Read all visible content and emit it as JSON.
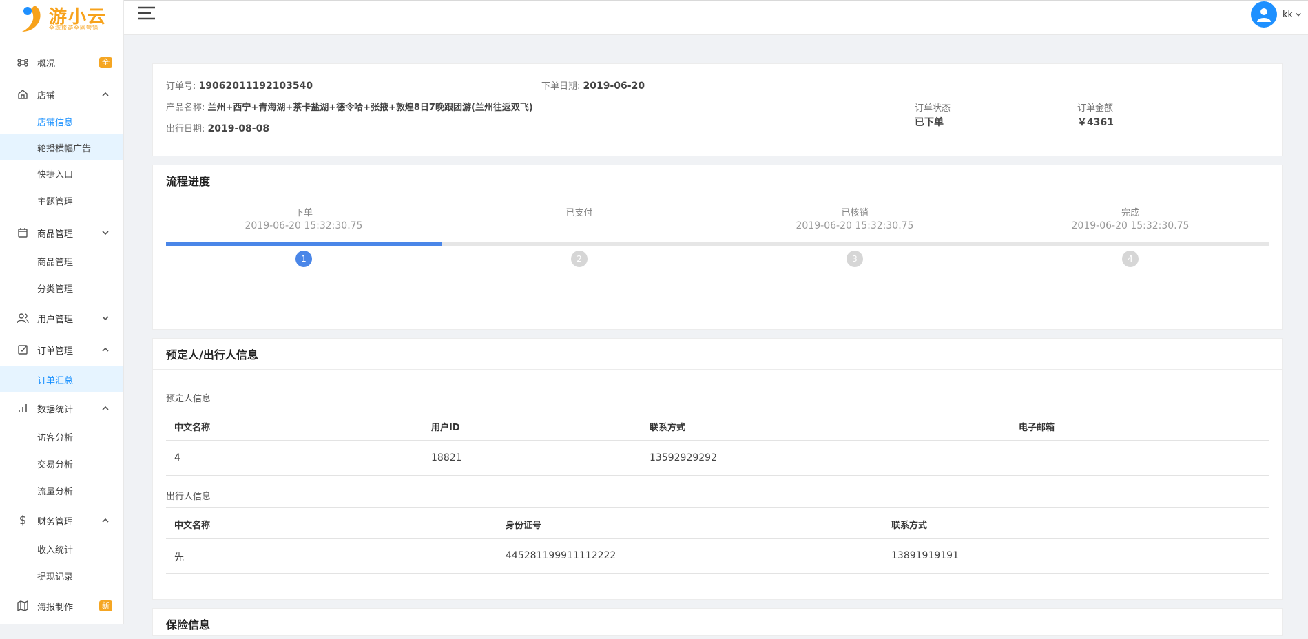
{
  "brand": {
    "name": "游小云",
    "tagline": "全域旅游全网营销",
    "accent": "#f7a21b"
  },
  "sidebar": {
    "items": [
      {
        "label": "概况",
        "badge": "全",
        "icon": "command-icon"
      },
      {
        "label": "店铺",
        "icon": "home-icon",
        "expanded": true,
        "children": [
          "店铺信息",
          "轮播横幅广告",
          "快捷入口",
          "主题管理"
        ]
      },
      {
        "label": "商品管理",
        "icon": "calendar-icon",
        "expanded": true,
        "children": [
          "商品管理",
          "分类管理"
        ]
      },
      {
        "label": "用户管理",
        "icon": "users-icon"
      },
      {
        "label": "订单管理",
        "icon": "check-square-icon",
        "expanded": true,
        "children": [
          "订单汇总"
        ]
      },
      {
        "label": "数据统计",
        "icon": "bar-chart-icon",
        "expanded": true,
        "children": [
          "访客分析",
          "交易分析",
          "流量分析"
        ]
      },
      {
        "label": "财务管理",
        "icon": "dollar-icon",
        "expanded": true,
        "children": [
          "收入统计",
          "提现记录"
        ]
      },
      {
        "label": "海报制作",
        "badge": "新",
        "icon": "map-icon"
      }
    ]
  },
  "header": {
    "username": "kk"
  },
  "order": {
    "order_no_label": "订单号:",
    "order_no": "19062011192103540",
    "order_date_label": "下单日期:",
    "order_date": "2019-06-20",
    "product_label": "产品名称:",
    "product_name": "兰州+西宁+青海湖+茶卡盐湖+德令哈+张掖+敦煌8日7晚跟团游(兰州往返双飞)",
    "travel_date_label": "出行日期:",
    "travel_date": "2019-08-08",
    "status_label": "订单状态",
    "status": "已下单",
    "amount_label": "订单金额",
    "amount": "￥4361"
  },
  "progress": {
    "title": "流程进度",
    "current_step": 1,
    "percent_complete": 25,
    "steps": [
      {
        "label": "下单",
        "time": "2019-06-20 15:32:30.75",
        "num": "1"
      },
      {
        "label": "已支付",
        "time": "",
        "num": "2"
      },
      {
        "label": "已核销",
        "time": "2019-06-20 15:32:30.75",
        "num": "3"
      },
      {
        "label": "完成",
        "time": "2019-06-20 15:32:30.75",
        "num": "4"
      }
    ]
  },
  "people": {
    "title": "预定人/出行人信息",
    "booker": {
      "label": "预定人信息",
      "columns": [
        "中文名称",
        "用户ID",
        "联系方式",
        "电子邮箱"
      ],
      "rows": [
        [
          "4",
          "18821",
          "13592929292",
          ""
        ]
      ]
    },
    "traveler": {
      "label": "出行人信息",
      "columns": [
        "中文名称",
        "身份证号",
        "联系方式"
      ],
      "rows": [
        [
          "先",
          "445281199911112222",
          "13891919191"
        ]
      ]
    }
  },
  "insurance": {
    "title": "保险信息"
  }
}
